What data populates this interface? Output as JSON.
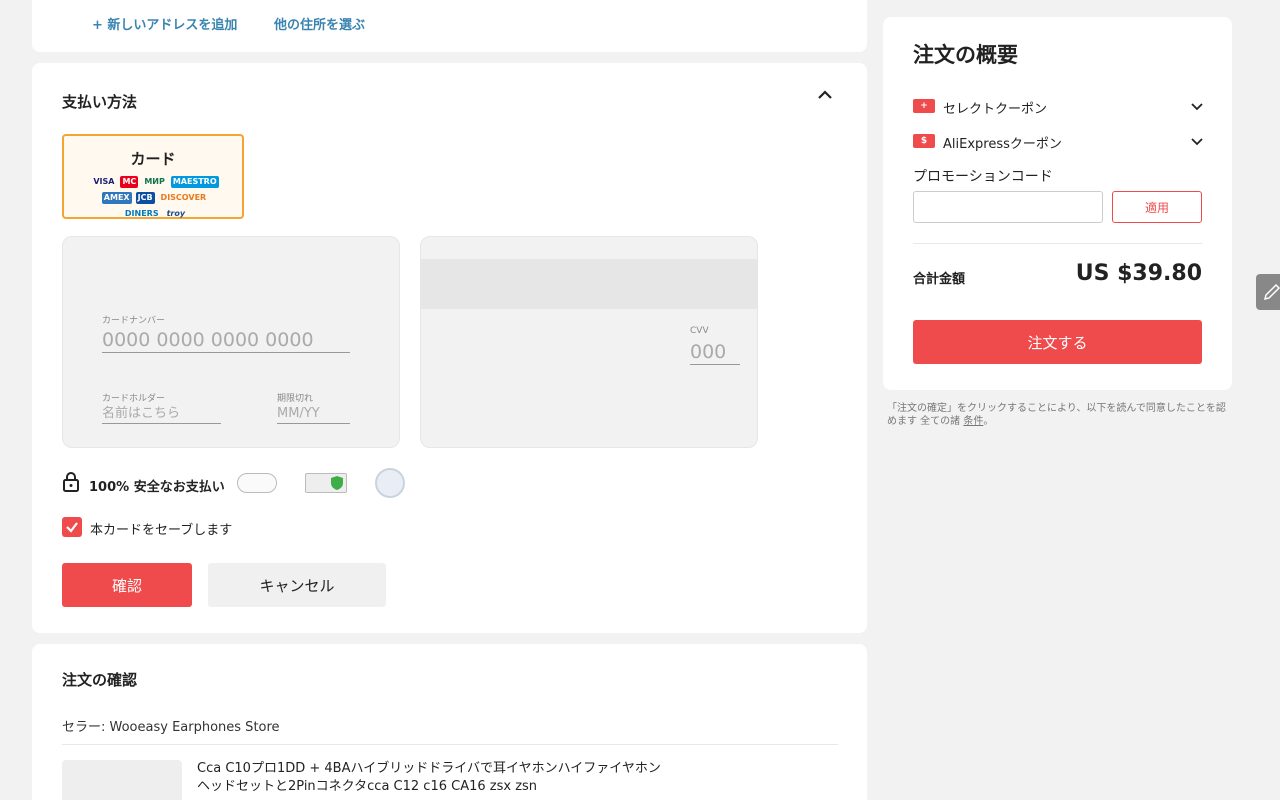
{
  "address": {
    "add_new": "+ 新しいアドレスを追加",
    "choose_other": "他の住所を選ぶ"
  },
  "payment": {
    "title": "支払い方法",
    "card_label": "カード",
    "card_brands": [
      "VISA",
      "MC",
      "МИР",
      "MAESTRO",
      "AMEX",
      "JCB",
      "DISCOVER",
      "DINERS",
      "troy"
    ],
    "card_number_label": "カードナンバー",
    "card_number_placeholder": "0000 0000 0000 0000",
    "holder_label": "カードホルダー",
    "holder_placeholder": "名前はこちら",
    "expiry_label": "期限切れ",
    "expiry_placeholder": "MM/YY",
    "cvv_label": "CVV",
    "cvv_placeholder": "000",
    "secure_text": "100% 安全なお支払い",
    "save_card": "本カードをセーブします",
    "save_checked": true,
    "confirm": "確認",
    "cancel": "キャンセル"
  },
  "review": {
    "title": "注文の確認",
    "seller": "セラー: Wooeasy Earphones Store",
    "product_name": "Cca C10プロ1DD + 4BAハイブリッドドライバで耳イヤホンハイファイヤホンヘッドセットと2Pinコネクタcca C12 c16 CA16 zsx zsn"
  },
  "summary": {
    "title": "注文の概要",
    "select_coupon": "セレクトクーポン",
    "ali_coupon": "AliExpressクーポン",
    "promo_label": "プロモーションコード",
    "apply": "適用",
    "total_label": "合計金額",
    "total_value": "US $39.80",
    "order_button": "注文する",
    "terms": "「注文の確定」をクリックすることにより、以下を読んで同意したことを認めます 全ての諸",
    "terms_link": "条件",
    "terms_end": "。"
  },
  "colors": {
    "accent": "#f04b4c",
    "link": "#3a84b0",
    "selected_border": "#f4a430"
  }
}
